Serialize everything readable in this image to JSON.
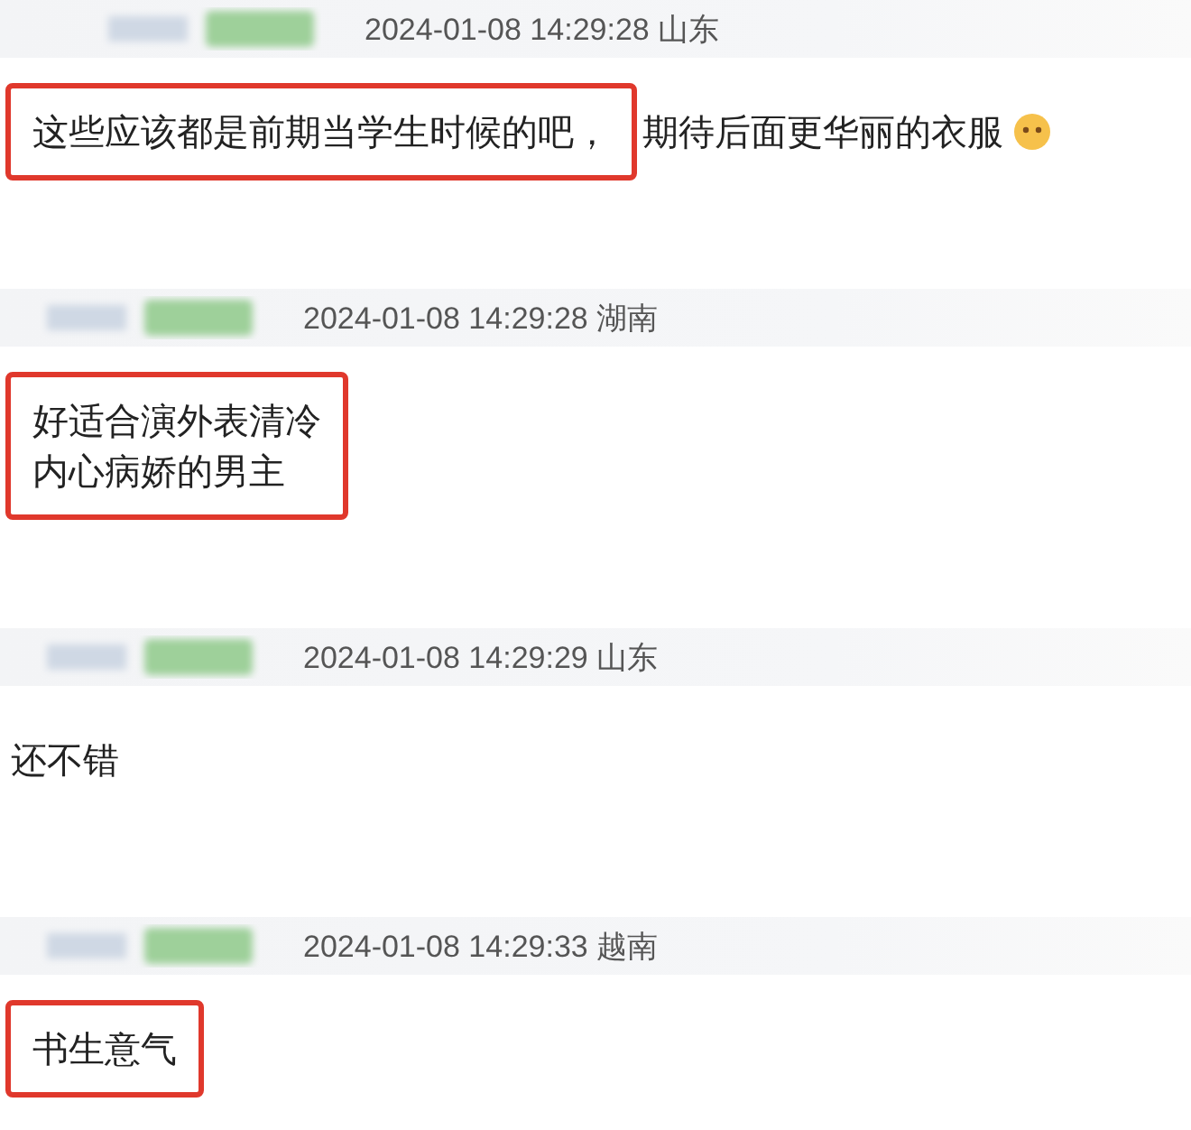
{
  "comments": [
    {
      "time": "2024-01-08 14:29:28",
      "location": "山东",
      "segments": [
        {
          "kind": "text",
          "boxed": true,
          "lines": [
            "这些应该都是前期当学生时候的吧，"
          ]
        },
        {
          "kind": "text",
          "boxed": false,
          "lines": [
            "期待后面更华丽的衣服"
          ]
        },
        {
          "kind": "emoji"
        }
      ]
    },
    {
      "time": "2024-01-08 14:29:28",
      "location": "湖南",
      "segments": [
        {
          "kind": "text",
          "boxed": true,
          "lines": [
            "好适合演外表清冷",
            "内心病娇的男主"
          ]
        }
      ]
    },
    {
      "time": "2024-01-08 14:29:29",
      "location": "山东",
      "segments": [
        {
          "kind": "text",
          "boxed": false,
          "lines": [
            "还不错"
          ]
        }
      ]
    },
    {
      "time": "2024-01-08 14:29:33",
      "location": "越南",
      "segments": [
        {
          "kind": "text",
          "boxed": true,
          "lines": [
            "书生意气"
          ]
        }
      ]
    }
  ]
}
